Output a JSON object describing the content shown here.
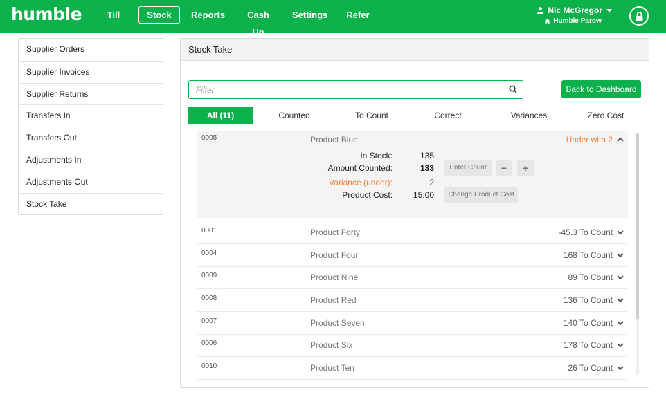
{
  "brand": {
    "name": "humble",
    "accent": "#0db14b"
  },
  "nav": {
    "items": [
      "Till",
      "Stock",
      "Reports",
      "Cash Up",
      "Settings",
      "Refer"
    ],
    "active": "Stock"
  },
  "user": {
    "name": "Nic McGregor",
    "store": "Humble Parow"
  },
  "sidebar": {
    "items": [
      "Supplier Orders",
      "Supplier Invoices",
      "Supplier Returns",
      "Transfers In",
      "Transfers Out",
      "Adjustments In",
      "Adjustments Out",
      "Stock Take"
    ]
  },
  "panel": {
    "title": "Stock Take",
    "filter_placeholder": "Filter",
    "back_button": "Back to Dashboard",
    "tabs": [
      "All (11)",
      "Counted",
      "To Count",
      "Correct",
      "Variances",
      "Zero Cost"
    ],
    "active_tab": "All (11)"
  },
  "expanded_product": {
    "code": "0005",
    "name": "Product Blue",
    "status": "Under with 2",
    "in_stock_label": "In Stock:",
    "in_stock": "135",
    "amount_counted_label": "Amount Counted:",
    "amount_counted": "133",
    "variance_label": "Variance (under):",
    "variance": "2",
    "product_cost_label": "Product Cost:",
    "product_cost": "15.00",
    "enter_count_button": "Enter Count",
    "minus_button": "−",
    "plus_button": "+",
    "change_cost_button": "Change Product Cost"
  },
  "products": [
    {
      "code": "0001",
      "name": "Product Forty",
      "status": "-45.3 To Count"
    },
    {
      "code": "0004",
      "name": "Product Four",
      "status": "168 To Count"
    },
    {
      "code": "0009",
      "name": "Product Nine",
      "status": "89 To Count"
    },
    {
      "code": "0008",
      "name": "Product Red",
      "status": "136 To Count"
    },
    {
      "code": "0007",
      "name": "Product Seven",
      "status": "140 To Count"
    },
    {
      "code": "0006",
      "name": "Product Six",
      "status": "178 To Count"
    },
    {
      "code": "0010",
      "name": "Product Ten",
      "status": "26 To Count"
    }
  ]
}
